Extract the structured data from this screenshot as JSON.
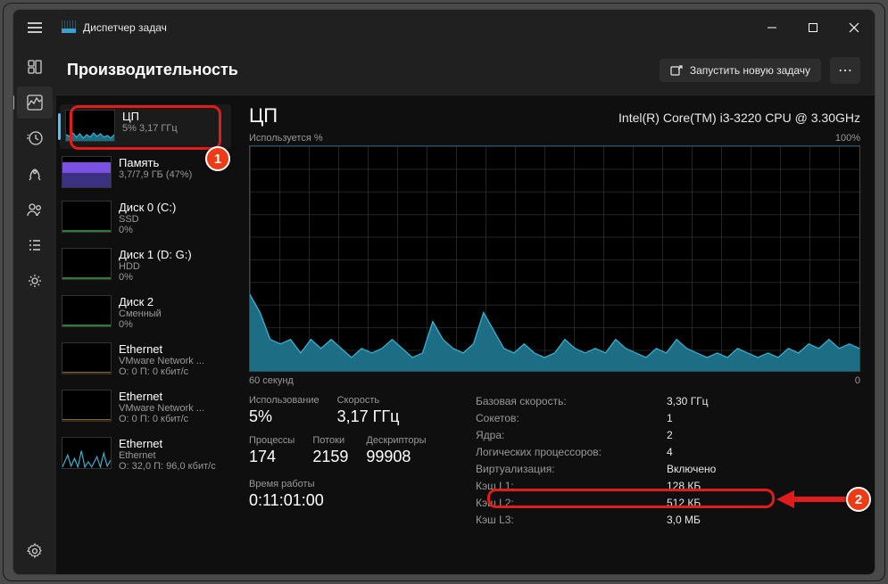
{
  "window": {
    "title": "Диспетчер задач"
  },
  "page": {
    "title": "Производительность",
    "run_task": "Запустить новую задачу"
  },
  "sidebar": {
    "items": [
      {
        "name": "ЦП",
        "sub": "5% 3,17 ГГц"
      },
      {
        "name": "Память",
        "sub": "3,7/7,9 ГБ (47%)"
      },
      {
        "name": "Диск 0 (C:)",
        "sub": "SSD",
        "sub2": "0%"
      },
      {
        "name": "Диск 1 (D: G:)",
        "sub": "HDD",
        "sub2": "0%"
      },
      {
        "name": "Диск 2",
        "sub": "Сменный",
        "sub2": "0%"
      },
      {
        "name": "Ethernet",
        "sub": "VMware Network ...",
        "sub2": "О: 0 П: 0 кбит/с"
      },
      {
        "name": "Ethernet",
        "sub": "VMware Network ...",
        "sub2": "О: 0 П: 0 кбит/с"
      },
      {
        "name": "Ethernet",
        "sub": "Ethernet",
        "sub2": "О: 32,0 П: 96,0 кбит/с"
      }
    ]
  },
  "detail": {
    "title": "ЦП",
    "model": "Intel(R) Core(TM) i3-3220 CPU @ 3.30GHz",
    "y_label": "Используется %",
    "y_max": "100%",
    "x_left": "60 секунд",
    "x_right": "0",
    "stats_left": {
      "usage_label": "Использование",
      "usage": "5%",
      "speed_label": "Скорость",
      "speed": "3,17 ГГц",
      "proc_label": "Процессы",
      "proc": "174",
      "threads_label": "Потоки",
      "threads": "2159",
      "handles_label": "Дескрипторы",
      "handles": "99908",
      "uptime_label": "Время работы",
      "uptime": "0:11:01:00"
    },
    "stats_right": [
      {
        "label": "Базовая скорость:",
        "val": "3,30 ГГц"
      },
      {
        "label": "Сокетов:",
        "val": "1"
      },
      {
        "label": "Ядра:",
        "val": "2"
      },
      {
        "label": "Логических процессоров:",
        "val": "4"
      },
      {
        "label": "Виртуализация:",
        "val": "Включено"
      },
      {
        "label": "Кэш L1:",
        "val": "128 КБ"
      },
      {
        "label": "Кэш L2:",
        "val": "512 КБ"
      },
      {
        "label": "Кэш L3:",
        "val": "3,0 МБ"
      }
    ]
  },
  "chart_data": {
    "type": "area",
    "title": "Используется %",
    "xlabel": "60 секунд",
    "ylabel": "%",
    "ylim": [
      0,
      100
    ],
    "x": [
      0,
      1,
      2,
      3,
      4,
      5,
      6,
      7,
      8,
      9,
      10,
      11,
      12,
      13,
      14,
      15,
      16,
      17,
      18,
      19,
      20,
      21,
      22,
      23,
      24,
      25,
      26,
      27,
      28,
      29,
      30,
      31,
      32,
      33,
      34,
      35,
      36,
      37,
      38,
      39,
      40,
      41,
      42,
      43,
      44,
      45,
      46,
      47,
      48,
      49,
      50,
      51,
      52,
      53,
      54,
      55,
      56,
      57,
      58,
      59,
      60
    ],
    "values": [
      34,
      26,
      14,
      12,
      14,
      8,
      14,
      10,
      14,
      10,
      6,
      10,
      8,
      10,
      14,
      10,
      6,
      8,
      22,
      14,
      10,
      8,
      12,
      26,
      18,
      10,
      8,
      12,
      8,
      6,
      8,
      14,
      10,
      8,
      10,
      8,
      14,
      10,
      8,
      6,
      10,
      8,
      14,
      10,
      8,
      6,
      8,
      6,
      10,
      8,
      6,
      8,
      6,
      10,
      8,
      12,
      10,
      14,
      10,
      12,
      10
    ]
  },
  "annotations": {
    "badge1": "1",
    "badge2": "2"
  }
}
